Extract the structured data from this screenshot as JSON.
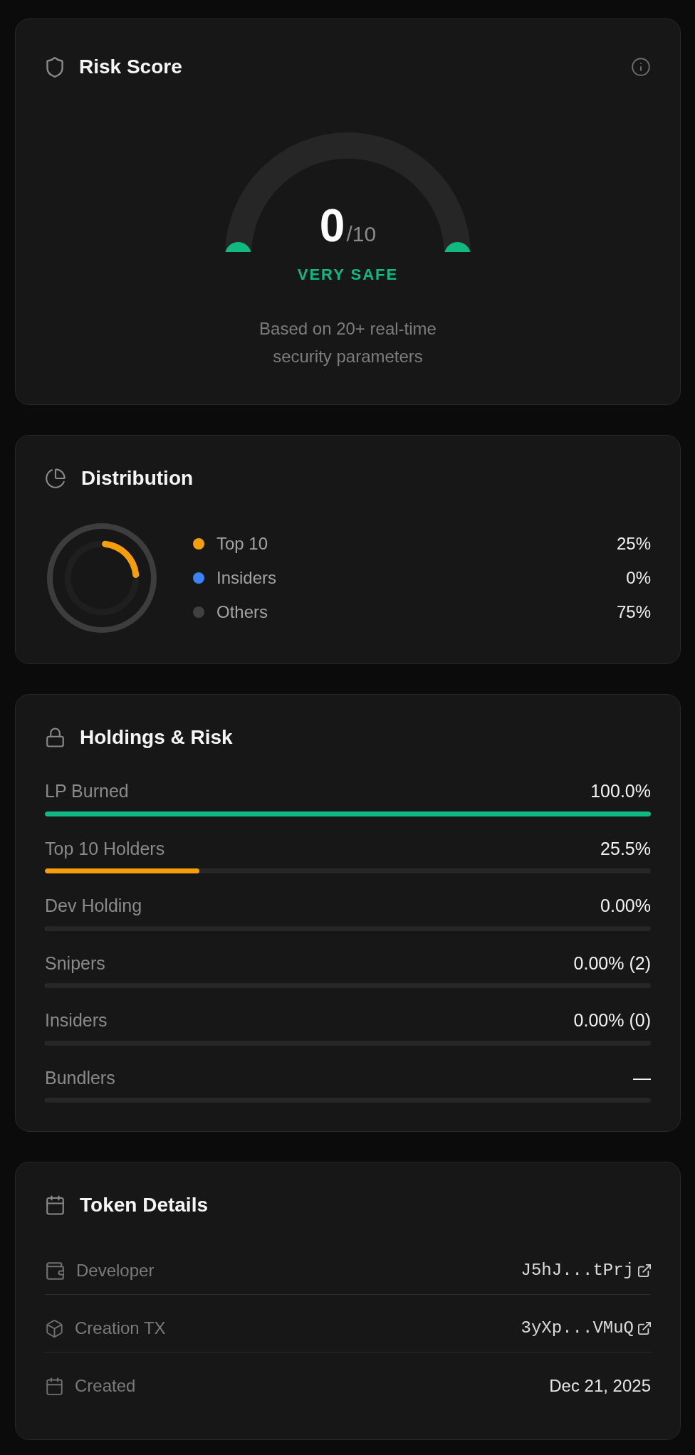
{
  "risk_score": {
    "title": "Risk Score",
    "score": "0",
    "max": "/10",
    "level": 0,
    "rating": "VERY SAFE",
    "description": "Based on 20+ real-time security parameters"
  },
  "distribution": {
    "title": "Distribution",
    "chart_data": {
      "type": "donut",
      "values": [
        25,
        0,
        75
      ],
      "colors": [
        "#f59e0b",
        "#3b82f6",
        "#1f1f1f"
      ]
    },
    "legend": [
      {
        "label": "Top 10",
        "value": "25%",
        "color": "#f59e0b"
      },
      {
        "label": "Insiders",
        "value": "0%",
        "color": "#3b82f6"
      },
      {
        "label": "Others",
        "value": "75%",
        "color": "#404040"
      }
    ]
  },
  "holdings": {
    "title": "Holdings & Risk",
    "rows": [
      {
        "label": "LP Burned",
        "value": "100.0%",
        "level": 1,
        "color": "#10b981"
      },
      {
        "label": "Top 10 Holders",
        "value": "25.5%",
        "level": 0.255,
        "color": "#f59e0b"
      },
      {
        "label": "Dev Holding",
        "value": "0.00%",
        "level": 0
      },
      {
        "label": "Snipers",
        "value": "0.00% (2)",
        "level": 0
      },
      {
        "label": "Insiders",
        "value": "0.00% (0)",
        "level": 0
      },
      {
        "label": "Bundlers",
        "value": "—",
        "level": 0
      }
    ]
  },
  "token_details": {
    "title": "Token Details",
    "rows": [
      {
        "kind": "wallet",
        "label": "Developer",
        "value": "J5hJ...tPrj"
      },
      {
        "kind": "transaction",
        "label": "Creation TX",
        "value": "3yXp...VMuQ"
      },
      {
        "kind": "date",
        "label": "Created",
        "value": "Dec 21, 2025"
      }
    ]
  }
}
